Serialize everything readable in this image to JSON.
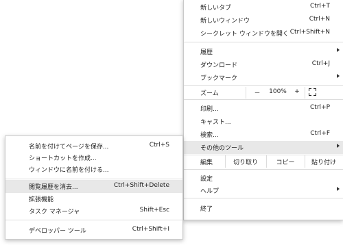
{
  "main_menu": {
    "new_tab": {
      "label": "新しいタブ",
      "shortcut": "Ctrl+T"
    },
    "new_window": {
      "label": "新しいウィンドウ",
      "shortcut": "Ctrl+N"
    },
    "incognito": {
      "label": "シークレット ウィンドウを開く",
      "shortcut": "Ctrl+Shift+N"
    },
    "history": {
      "label": "履歴"
    },
    "downloads": {
      "label": "ダウンロード",
      "shortcut": "Ctrl+J"
    },
    "bookmarks": {
      "label": "ブックマーク"
    },
    "zoom": {
      "label": "ズーム",
      "minus": "－",
      "value": "100%",
      "plus": "+"
    },
    "print": {
      "label": "印刷...",
      "shortcut": "Ctrl+P"
    },
    "cast": {
      "label": "キャスト..."
    },
    "find": {
      "label": "検索...",
      "shortcut": "Ctrl+F"
    },
    "more_tools": {
      "label": "その他のツール"
    },
    "edit": {
      "label": "編集",
      "cut": "切り取り",
      "copy": "コピー",
      "paste": "貼り付け"
    },
    "settings": {
      "label": "設定"
    },
    "help": {
      "label": "ヘルプ"
    },
    "exit": {
      "label": "終了"
    }
  },
  "submenu": {
    "save_page": {
      "label": "名前を付けてページを保存...",
      "shortcut": "Ctrl+S"
    },
    "create_shortcut": {
      "label": "ショートカットを作成..."
    },
    "name_window": {
      "label": "ウィンドウに名前を付ける..."
    },
    "clear_history": {
      "label": "閲覧履歴を消去...",
      "shortcut": "Ctrl+Shift+Delete"
    },
    "extensions": {
      "label": "拡張機能"
    },
    "task_manager": {
      "label": "タスク マネージャ",
      "shortcut": "Shift+Esc"
    },
    "dev_tools": {
      "label": "デベロッパー ツール",
      "shortcut": "Ctrl+Shift+I"
    }
  },
  "colors": {
    "highlight": "#e8e8e8",
    "separator": "#dcdcdc",
    "menu_bg": "#ffffff"
  }
}
